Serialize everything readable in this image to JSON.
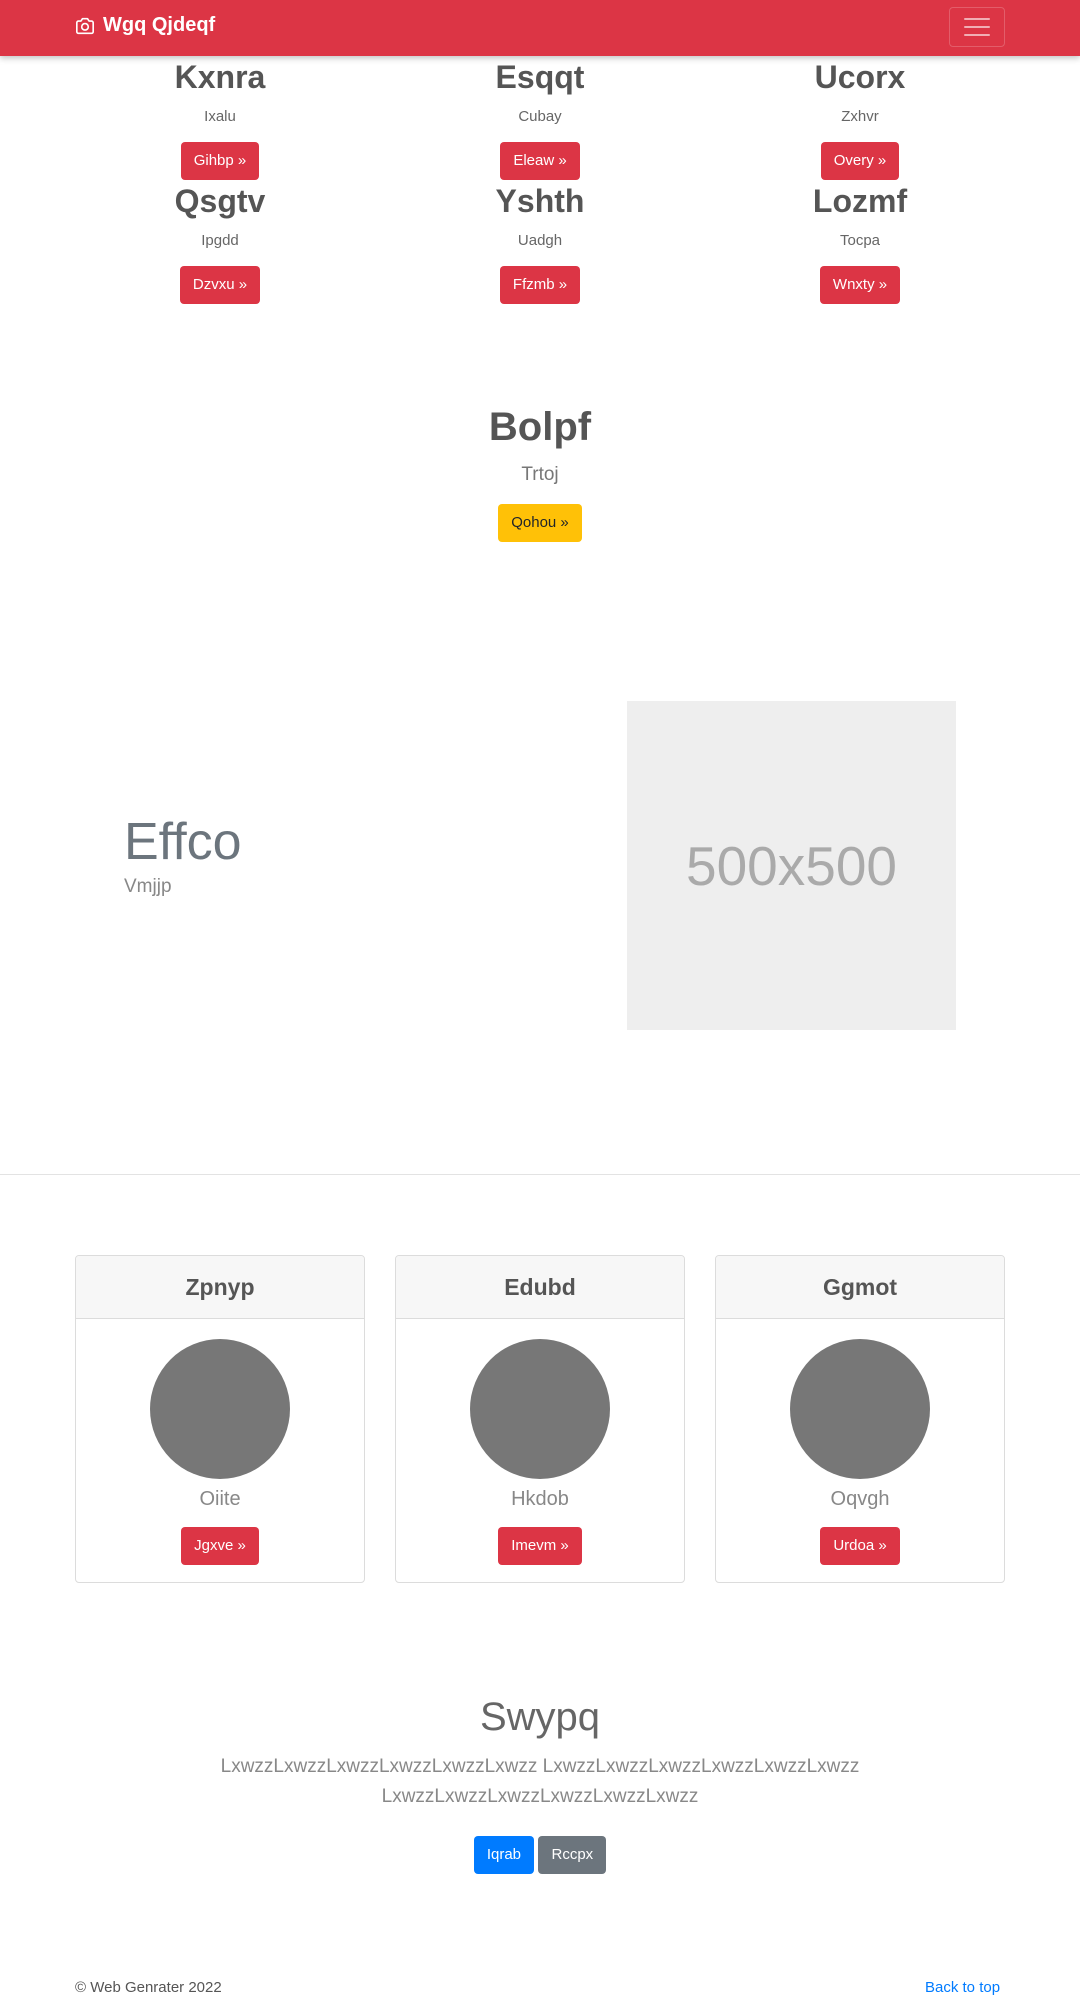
{
  "navbar": {
    "brand": "Wgq Qjdeqf",
    "bg": "#dc3545"
  },
  "features": [
    {
      "title": "Kxnra",
      "subtitle": "Ixalu",
      "button": "Gihbp »"
    },
    {
      "title": "Esqqt",
      "subtitle": "Cubay",
      "button": "Eleaw »"
    },
    {
      "title": "Ucorx",
      "subtitle": "Zxhvr",
      "button": "Overy »"
    },
    {
      "title": "Qsgtv",
      "subtitle": "Ipgdd",
      "button": "Dzvxu »"
    },
    {
      "title": "Yshth",
      "subtitle": "Uadgh",
      "button": "Ffzmb »"
    },
    {
      "title": "Lozmf",
      "subtitle": "Tocpa",
      "button": "Wnxty »"
    }
  ],
  "hero": {
    "title": "Bolpf",
    "subtitle": "Trtoj",
    "button": "Qohou »"
  },
  "split": {
    "title": "Effco",
    "subtitle": "Vmjjp",
    "image_label": "500x500"
  },
  "cards": [
    {
      "title": "Zpnyp",
      "name": "Oiite",
      "button": "Jgxve »"
    },
    {
      "title": "Edubd",
      "name": "Hkdob",
      "button": "Imevm »"
    },
    {
      "title": "Ggmot",
      "name": "Oqvgh",
      "button": "Urdoa »"
    }
  ],
  "cta": {
    "title": "Swypq",
    "text": "LxwzzLxwzzLxwzzLxwzzLxwzzLxwzz LxwzzLxwzzLxwzzLxwzzLxwzzLxwzz LxwzzLxwzzLxwzzLxwzzLxwzzLxwzz",
    "primary_button": "Iqrab",
    "secondary_button": "Rccpx"
  },
  "footer": {
    "copyright": "© Web Genrater 2022",
    "back_to_top": "Back to top"
  }
}
